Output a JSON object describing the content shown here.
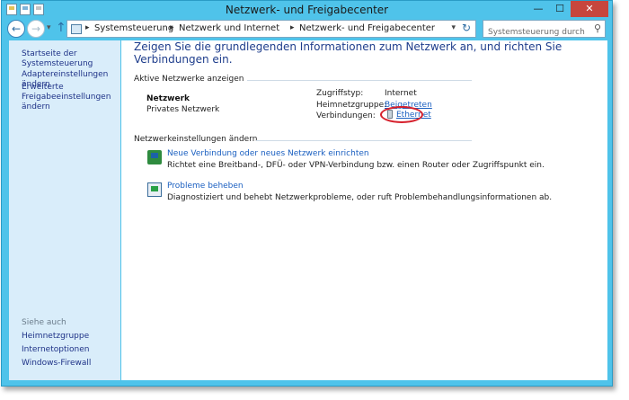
{
  "window": {
    "title": "Netzwerk- und Freigabecenter"
  },
  "navigation": {
    "breadcrumbs": [
      "Systemsteuerung",
      "Netzwerk und Internet",
      "Netzwerk- und Freigabecenter"
    ],
    "search_placeholder": "Systemsteuerung durchsuchen"
  },
  "sidebar": {
    "home": "Startseite der Systemsteuerung",
    "items": [
      "Adaptereinstellungen ändern",
      "Erweiterte Freigabeeinstellungen ändern"
    ],
    "see_also_title": "Siehe auch",
    "see_also": [
      "Heimnetzgruppe",
      "Internetoptionen",
      "Windows-Firewall"
    ]
  },
  "main": {
    "heading": "Zeigen Sie die grundlegenden Informationen zum Netzwerk an, und richten Sie Verbindungen ein.",
    "active_networks": {
      "title": "Aktive Netzwerke anzeigen",
      "network_name": "Netzwerk",
      "network_type": "Privates Netzwerk",
      "access_type_label": "Zugriffstyp:",
      "access_type_value": "Internet",
      "homegroup_label": "Heimnetzgruppe:",
      "homegroup_value": "Beigetreten",
      "connections_label": "Verbindungen:",
      "connections_value": "Ethernet"
    },
    "change_settings": {
      "title": "Netzwerkeinstellungen ändern",
      "tasks": [
        {
          "link": "Neue Verbindung oder neues Netzwerk einrichten",
          "description": "Richtet eine Breitband-, DFÜ- oder VPN-Verbindung bzw. einen Router oder Zugriffspunkt ein."
        },
        {
          "link": "Probleme beheben",
          "description": "Diagnostiziert und behebt Netzwerkprobleme, oder ruft Problembehandlungsinformationen ab."
        }
      ]
    }
  },
  "colors": {
    "frame": "#4fc3ea",
    "sidebar": "#d9edfa",
    "heading": "#1e3d8c",
    "link": "#1a5fc0",
    "highlight": "#d6202c"
  }
}
